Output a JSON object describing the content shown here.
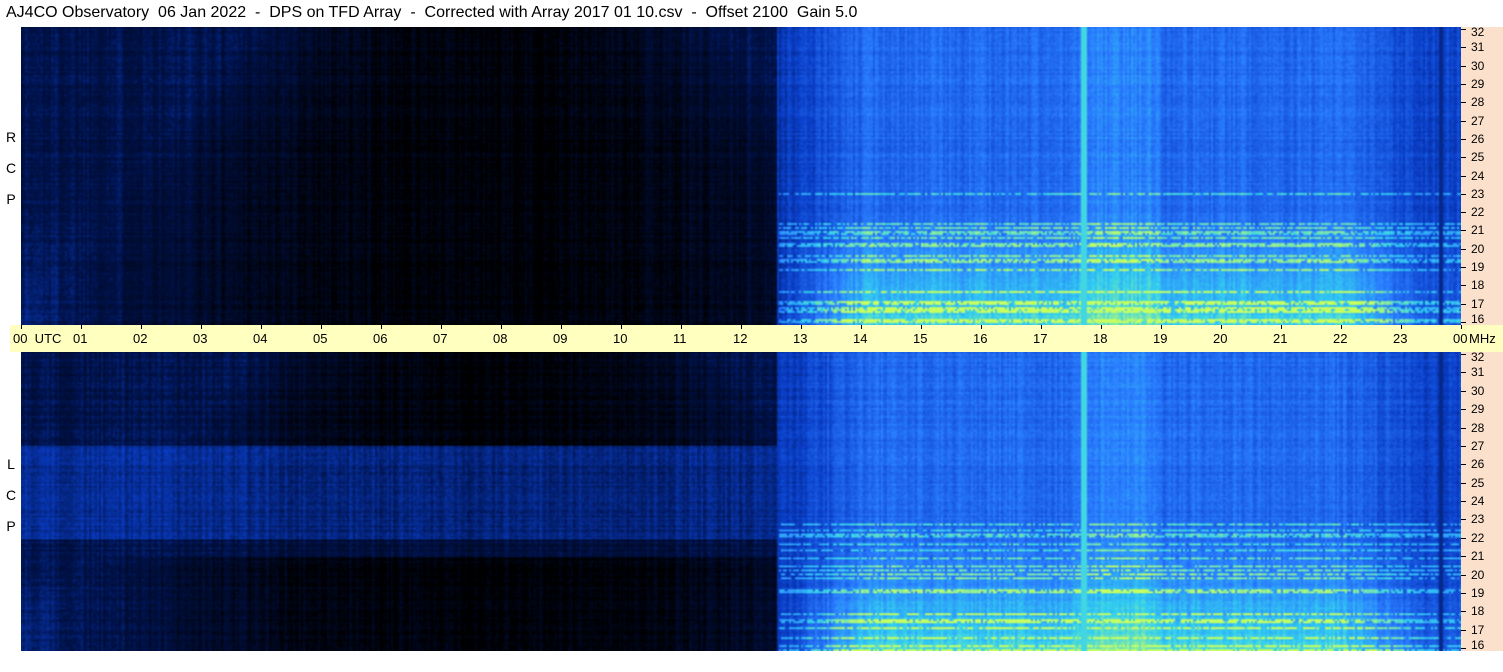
{
  "title": "AJ4CO Observatory  06 Jan 2022  -  DPS on TFD Array  -  Corrected with Array 2017 01 10.csv  -  Offset 2100  Gain 5.0",
  "panels": [
    {
      "id": "rcp",
      "label_letters": [
        "R",
        "C",
        "P"
      ]
    },
    {
      "id": "lcp",
      "label_letters": [
        "L",
        "C",
        "P"
      ]
    }
  ],
  "time_axis": {
    "labels": [
      "00  UTC",
      "01",
      "02",
      "03",
      "04",
      "05",
      "06",
      "07",
      "08",
      "09",
      "10",
      "11",
      "12",
      "13",
      "14",
      "15",
      "16",
      "17",
      "18",
      "19",
      "20",
      "21",
      "22",
      "23",
      "00"
    ]
  },
  "freq_axis": {
    "unit": "MHz",
    "labels": [
      "32",
      "31",
      "30",
      "29",
      "28",
      "27",
      "26",
      "25",
      "24",
      "23",
      "22",
      "21",
      "20",
      "19",
      "18",
      "17",
      "16"
    ]
  },
  "chart_data": {
    "type": "heatmap",
    "title": "AJ4CO Observatory  06 Jan 2022  -  DPS on TFD Array  -  Corrected with Array 2017 01 10.csv  -  Offset 2100  Gain 5.0",
    "x_unit": "UTC",
    "x_range": [
      "00",
      "00"
    ],
    "y_unit": "MHz",
    "y_range": [
      16,
      32
    ],
    "series": [
      {
        "name": "RCP"
      },
      {
        "name": "LCP"
      }
    ],
    "colormap": [
      "#000000",
      "#00124a",
      "#0a3ec8",
      "#2a7cff",
      "#33d0f0",
      "#c8ff60"
    ],
    "features": {
      "night_dark_region_utc": [
        0,
        12.6
      ],
      "day_onset_utc": 12.6,
      "vertical_marker_utc": 17.7,
      "brightest_band_mhz": [
        16,
        22
      ]
    }
  }
}
